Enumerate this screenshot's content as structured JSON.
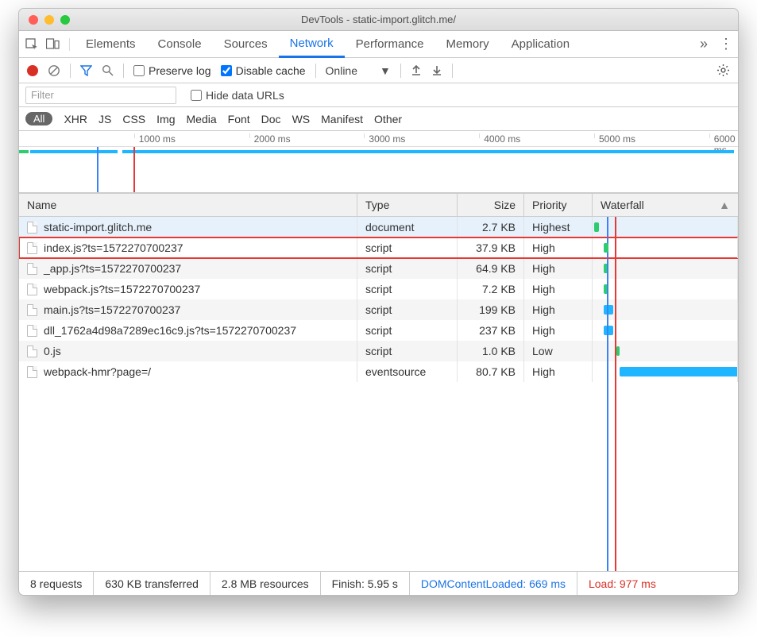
{
  "window": {
    "title": "DevTools - static-import.glitch.me/"
  },
  "tabs": {
    "items": [
      "Elements",
      "Console",
      "Sources",
      "Network",
      "Performance",
      "Memory",
      "Application"
    ],
    "active": "Network"
  },
  "toolbar": {
    "preserve_log": "Preserve log",
    "disable_cache": "Disable cache",
    "throttle": "Online"
  },
  "filter": {
    "placeholder": "Filter",
    "hide_data_urls": "Hide data URLs"
  },
  "types": [
    "All",
    "XHR",
    "JS",
    "CSS",
    "Img",
    "Media",
    "Font",
    "Doc",
    "WS",
    "Manifest",
    "Other"
  ],
  "timeline": {
    "ticks": [
      "1000 ms",
      "2000 ms",
      "3000 ms",
      "4000 ms",
      "5000 ms",
      "6000 ms"
    ]
  },
  "columns": {
    "name": "Name",
    "type": "Type",
    "size": "Size",
    "priority": "Priority",
    "waterfall": "Waterfall"
  },
  "rows": [
    {
      "name": "static-import.glitch.me",
      "type": "document",
      "size": "2.7 KB",
      "priority": "Highest"
    },
    {
      "name": "index.js?ts=1572270700237",
      "type": "script",
      "size": "37.9 KB",
      "priority": "High",
      "highlight": true
    },
    {
      "name": "_app.js?ts=1572270700237",
      "type": "script",
      "size": "64.9 KB",
      "priority": "High"
    },
    {
      "name": "webpack.js?ts=1572270700237",
      "type": "script",
      "size": "7.2 KB",
      "priority": "High"
    },
    {
      "name": "main.js?ts=1572270700237",
      "type": "script",
      "size": "199 KB",
      "priority": "High"
    },
    {
      "name": "dll_1762a4d98a7289ec16c9.js?ts=1572270700237",
      "type": "script",
      "size": "237 KB",
      "priority": "High"
    },
    {
      "name": "0.js",
      "type": "script",
      "size": "1.0 KB",
      "priority": "Low"
    },
    {
      "name": "webpack-hmr?page=/",
      "type": "eventsource",
      "size": "80.7 KB",
      "priority": "High"
    }
  ],
  "footer": {
    "requests": "8 requests",
    "transferred": "630 KB transferred",
    "resources": "2.8 MB resources",
    "finish": "Finish: 5.95 s",
    "dcl": "DOMContentLoaded: 669 ms",
    "load": "Load: 977 ms"
  }
}
